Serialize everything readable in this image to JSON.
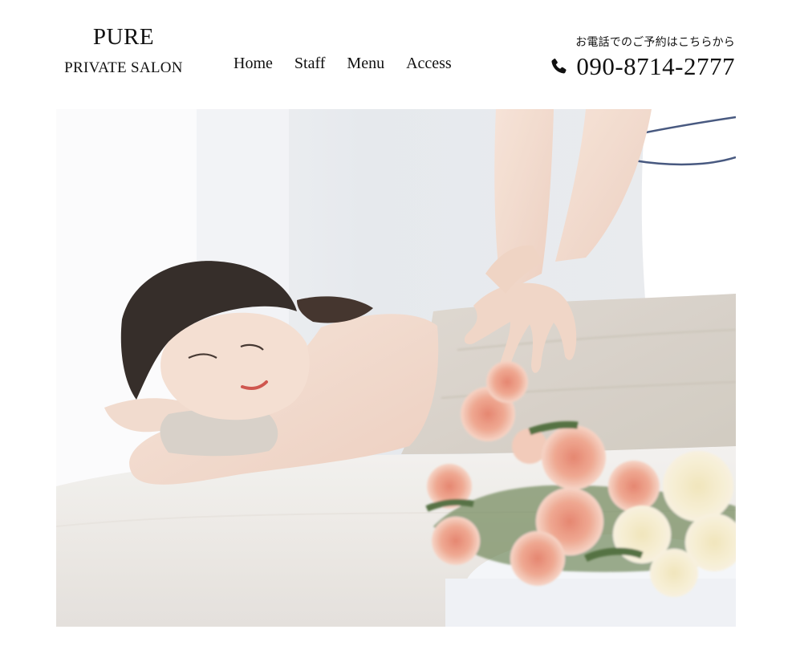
{
  "brand": {
    "title": "PURE",
    "subtitle": "PRIVATE SALON"
  },
  "nav": {
    "items": [
      {
        "label": "Home"
      },
      {
        "label": "Staff"
      },
      {
        "label": "Menu"
      },
      {
        "label": "Access"
      }
    ]
  },
  "contact": {
    "note": "お電話でのご予約はこちらから",
    "phone": "090-8714-2777",
    "icon": "phone-icon"
  },
  "hero": {
    "icon": "hero-photo"
  },
  "colors": {
    "text": "#111111",
    "background": "#ffffff",
    "towel": "#d8d2ca",
    "rose": "#e99a7f"
  }
}
